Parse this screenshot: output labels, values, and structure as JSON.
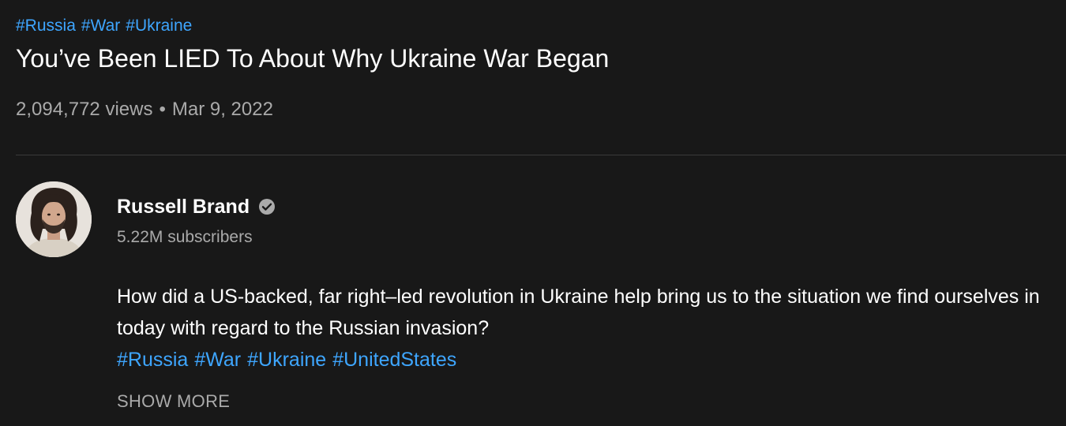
{
  "video": {
    "top_tags": [
      "#Russia",
      "#War",
      "#Ukraine"
    ],
    "title": "You’ve Been LIED To About Why Ukraine War Began",
    "views": "2,094,772 views",
    "separator": "•",
    "date": "Mar 9, 2022"
  },
  "channel": {
    "name": "Russell Brand",
    "verified_icon": "verified-check-icon",
    "subscribers": "5.22M subscribers"
  },
  "description": {
    "text": "How did a US-backed, far right–led revolution in Ukraine help bring us to the situation we find ourselves in today with regard to the Russian invasion?",
    "tags": [
      "#Russia",
      "#War",
      "#Ukraine",
      "#UnitedStates"
    ],
    "show_more_label": "SHOW MORE"
  },
  "colors": {
    "background": "#181818",
    "link": "#3ea6ff",
    "primary_text": "#ffffff",
    "secondary_text": "#aaaaaa",
    "divider": "#3a3a3a"
  }
}
